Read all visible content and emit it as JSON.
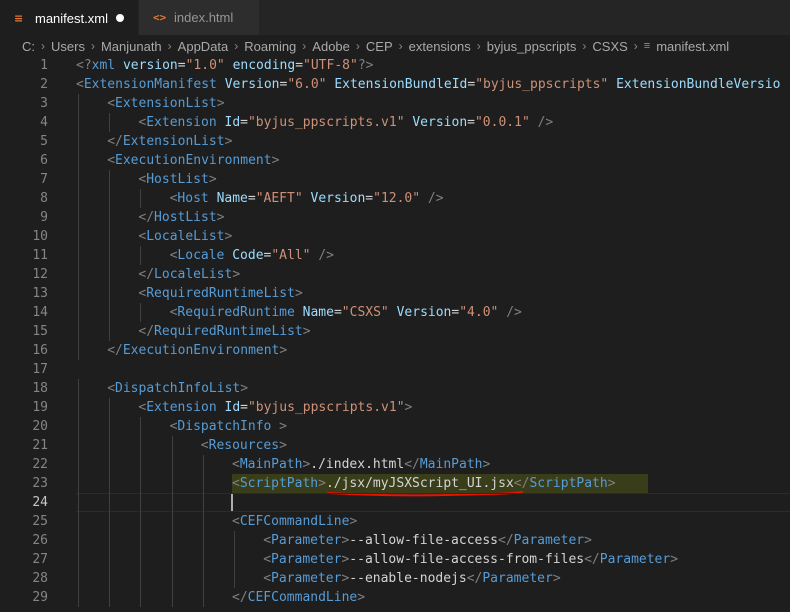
{
  "tabs": [
    {
      "label": "manifest.xml",
      "icon": "rss-icon",
      "active": true,
      "modified": true
    },
    {
      "label": "index.html",
      "icon": "html-code-icon",
      "active": false
    }
  ],
  "breadcrumb": [
    "C:",
    "Users",
    "Manjunath",
    "AppData",
    "Roaming",
    "Adobe",
    "CEP",
    "extensions",
    "byjus_ppscripts",
    "CSXS",
    "manifest.xml"
  ],
  "editor": {
    "current_line": 24,
    "highlighted_line": 23,
    "lines": [
      {
        "n": "1",
        "indent": 0,
        "tokens": [
          [
            "t",
            "<?"
          ],
          [
            "n",
            "xml"
          ],
          [
            "x",
            " "
          ],
          [
            "a",
            "version"
          ],
          [
            "x",
            "="
          ],
          [
            "s",
            "\"1.0\""
          ],
          [
            "x",
            " "
          ],
          [
            "a",
            "encoding"
          ],
          [
            "x",
            "="
          ],
          [
            "s",
            "\"UTF-8\""
          ],
          [
            "t",
            "?>"
          ]
        ]
      },
      {
        "n": "2",
        "indent": 0,
        "tokens": [
          [
            "t",
            "<"
          ],
          [
            "n",
            "ExtensionManifest"
          ],
          [
            "x",
            " "
          ],
          [
            "a",
            "Version"
          ],
          [
            "x",
            "="
          ],
          [
            "s",
            "\"6.0\""
          ],
          [
            "x",
            " "
          ],
          [
            "a",
            "ExtensionBundleId"
          ],
          [
            "x",
            "="
          ],
          [
            "s",
            "\"byjus_ppscripts\""
          ],
          [
            "x",
            " "
          ],
          [
            "a",
            "ExtensionBundleVersio"
          ]
        ]
      },
      {
        "n": "3",
        "indent": 1,
        "tokens": [
          [
            "t",
            "<"
          ],
          [
            "n",
            "ExtensionList"
          ],
          [
            "t",
            ">"
          ]
        ]
      },
      {
        "n": "4",
        "indent": 2,
        "tokens": [
          [
            "t",
            "<"
          ],
          [
            "n",
            "Extension"
          ],
          [
            "x",
            " "
          ],
          [
            "a",
            "Id"
          ],
          [
            "x",
            "="
          ],
          [
            "s",
            "\"byjus_ppscripts.v1\""
          ],
          [
            "x",
            " "
          ],
          [
            "a",
            "Version"
          ],
          [
            "x",
            "="
          ],
          [
            "s",
            "\"0.0.1\""
          ],
          [
            "x",
            " "
          ],
          [
            "t",
            "/>"
          ]
        ]
      },
      {
        "n": "5",
        "indent": 1,
        "tokens": [
          [
            "t",
            "</"
          ],
          [
            "n",
            "ExtensionList"
          ],
          [
            "t",
            ">"
          ]
        ]
      },
      {
        "n": "6",
        "indent": 1,
        "tokens": [
          [
            "t",
            "<"
          ],
          [
            "n",
            "ExecutionEnvironment"
          ],
          [
            "t",
            ">"
          ]
        ]
      },
      {
        "n": "7",
        "indent": 2,
        "tokens": [
          [
            "t",
            "<"
          ],
          [
            "n",
            "HostList"
          ],
          [
            "t",
            ">"
          ]
        ]
      },
      {
        "n": "8",
        "indent": 3,
        "tokens": [
          [
            "t",
            "<"
          ],
          [
            "n",
            "Host"
          ],
          [
            "x",
            " "
          ],
          [
            "a",
            "Name"
          ],
          [
            "x",
            "="
          ],
          [
            "s",
            "\"AEFT\""
          ],
          [
            "x",
            " "
          ],
          [
            "a",
            "Version"
          ],
          [
            "x",
            "="
          ],
          [
            "s",
            "\"12.0\""
          ],
          [
            "x",
            " "
          ],
          [
            "t",
            "/>"
          ]
        ]
      },
      {
        "n": "9",
        "indent": 2,
        "tokens": [
          [
            "t",
            "</"
          ],
          [
            "n",
            "HostList"
          ],
          [
            "t",
            ">"
          ]
        ]
      },
      {
        "n": "10",
        "indent": 2,
        "tokens": [
          [
            "t",
            "<"
          ],
          [
            "n",
            "LocaleList"
          ],
          [
            "t",
            ">"
          ]
        ]
      },
      {
        "n": "11",
        "indent": 3,
        "tokens": [
          [
            "t",
            "<"
          ],
          [
            "n",
            "Locale"
          ],
          [
            "x",
            " "
          ],
          [
            "a",
            "Code"
          ],
          [
            "x",
            "="
          ],
          [
            "s",
            "\"All\""
          ],
          [
            "x",
            " "
          ],
          [
            "t",
            "/>"
          ]
        ]
      },
      {
        "n": "12",
        "indent": 2,
        "tokens": [
          [
            "t",
            "</"
          ],
          [
            "n",
            "LocaleList"
          ],
          [
            "t",
            ">"
          ]
        ]
      },
      {
        "n": "13",
        "indent": 2,
        "tokens": [
          [
            "t",
            "<"
          ],
          [
            "n",
            "RequiredRuntimeList"
          ],
          [
            "t",
            ">"
          ]
        ]
      },
      {
        "n": "14",
        "indent": 3,
        "tokens": [
          [
            "t",
            "<"
          ],
          [
            "n",
            "RequiredRuntime"
          ],
          [
            "x",
            " "
          ],
          [
            "a",
            "Name"
          ],
          [
            "x",
            "="
          ],
          [
            "s",
            "\"CSXS\""
          ],
          [
            "x",
            " "
          ],
          [
            "a",
            "Version"
          ],
          [
            "x",
            "="
          ],
          [
            "s",
            "\"4.0\""
          ],
          [
            "x",
            " "
          ],
          [
            "t",
            "/>"
          ]
        ]
      },
      {
        "n": "15",
        "indent": 2,
        "tokens": [
          [
            "t",
            "</"
          ],
          [
            "n",
            "RequiredRuntimeList"
          ],
          [
            "t",
            ">"
          ]
        ]
      },
      {
        "n": "16",
        "indent": 1,
        "tokens": [
          [
            "t",
            "</"
          ],
          [
            "n",
            "ExecutionEnvironment"
          ],
          [
            "t",
            ">"
          ]
        ]
      },
      {
        "n": "17",
        "indent": 0,
        "tokens": []
      },
      {
        "n": "18",
        "indent": 1,
        "tokens": [
          [
            "t",
            "<"
          ],
          [
            "n",
            "DispatchInfoList"
          ],
          [
            "t",
            ">"
          ]
        ]
      },
      {
        "n": "19",
        "indent": 2,
        "tokens": [
          [
            "t",
            "<"
          ],
          [
            "n",
            "Extension"
          ],
          [
            "x",
            " "
          ],
          [
            "a",
            "Id"
          ],
          [
            "x",
            "="
          ],
          [
            "s",
            "\"byjus_ppscripts.v1\""
          ],
          [
            "t",
            ">"
          ]
        ]
      },
      {
        "n": "20",
        "indent": 3,
        "tokens": [
          [
            "t",
            "<"
          ],
          [
            "n",
            "DispatchInfo"
          ],
          [
            "x",
            " "
          ],
          [
            "t",
            ">"
          ]
        ]
      },
      {
        "n": "21",
        "indent": 4,
        "tokens": [
          [
            "t",
            "<"
          ],
          [
            "n",
            "Resources"
          ],
          [
            "t",
            ">"
          ]
        ]
      },
      {
        "n": "22",
        "indent": 5,
        "tokens": [
          [
            "t",
            "<"
          ],
          [
            "n",
            "MainPath"
          ],
          [
            "t",
            ">"
          ],
          [
            "x",
            "./index.html"
          ],
          [
            "t",
            "</"
          ],
          [
            "n",
            "MainPath"
          ],
          [
            "t",
            ">"
          ]
        ]
      },
      {
        "n": "23",
        "indent": 5,
        "tokens": [
          [
            "t",
            "<"
          ],
          [
            "n",
            "ScriptPath"
          ],
          [
            "t",
            ">"
          ],
          [
            "x",
            "./jsx/myJSXScript_UI.jsx"
          ],
          [
            "t",
            "</"
          ],
          [
            "n",
            "ScriptPath"
          ],
          [
            "t",
            ">"
          ]
        ]
      },
      {
        "n": "24",
        "indent": 5,
        "tokens": []
      },
      {
        "n": "25",
        "indent": 5,
        "tokens": [
          [
            "t",
            "<"
          ],
          [
            "n",
            "CEFCommandLine"
          ],
          [
            "t",
            ">"
          ]
        ]
      },
      {
        "n": "26",
        "indent": 6,
        "tokens": [
          [
            "t",
            "<"
          ],
          [
            "n",
            "Parameter"
          ],
          [
            "t",
            ">"
          ],
          [
            "x",
            "--allow-file-access"
          ],
          [
            "t",
            "</"
          ],
          [
            "n",
            "Parameter"
          ],
          [
            "t",
            ">"
          ]
        ]
      },
      {
        "n": "27",
        "indent": 6,
        "tokens": [
          [
            "t",
            "<"
          ],
          [
            "n",
            "Parameter"
          ],
          [
            "t",
            ">"
          ],
          [
            "x",
            "--allow-file-access-from-files"
          ],
          [
            "t",
            "</"
          ],
          [
            "n",
            "Parameter"
          ],
          [
            "t",
            ">"
          ]
        ]
      },
      {
        "n": "28",
        "indent": 6,
        "tokens": [
          [
            "t",
            "<"
          ],
          [
            "n",
            "Parameter"
          ],
          [
            "t",
            ">"
          ],
          [
            "x",
            "--enable-nodejs"
          ],
          [
            "t",
            "</"
          ],
          [
            "n",
            "Parameter"
          ],
          [
            "t",
            ">"
          ]
        ]
      },
      {
        "n": "29",
        "indent": 5,
        "tokens": [
          [
            "t",
            "</"
          ],
          [
            "n",
            "CEFCommandLine"
          ],
          [
            "t",
            ">"
          ]
        ]
      }
    ]
  },
  "colors": {
    "background": "#1e1e1e",
    "tag": "#569cd6",
    "attribute": "#9cdcfe",
    "string": "#ce9178",
    "annotation": "#e51400"
  }
}
